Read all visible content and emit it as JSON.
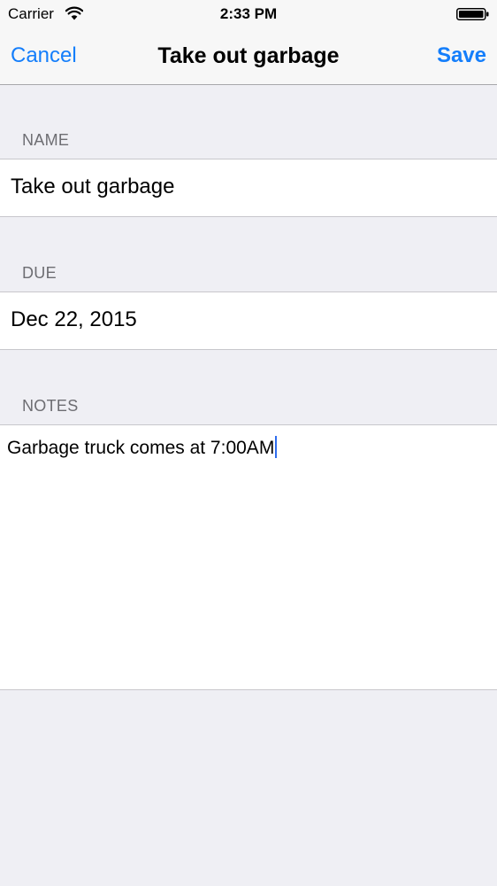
{
  "status_bar": {
    "carrier": "Carrier",
    "time": "2:33 PM",
    "wifi_icon": "wifi-icon",
    "battery_icon": "battery-icon"
  },
  "nav": {
    "cancel_label": "Cancel",
    "title": "Take out garbage",
    "save_label": "Save",
    "tint_color": "#147efb"
  },
  "form": {
    "name": {
      "header": "NAME",
      "value": "Take out garbage"
    },
    "due": {
      "header": "DUE",
      "value": "Dec 22, 2015"
    },
    "notes": {
      "header": "NOTES",
      "value": "Garbage truck comes at 7:00AM"
    }
  }
}
